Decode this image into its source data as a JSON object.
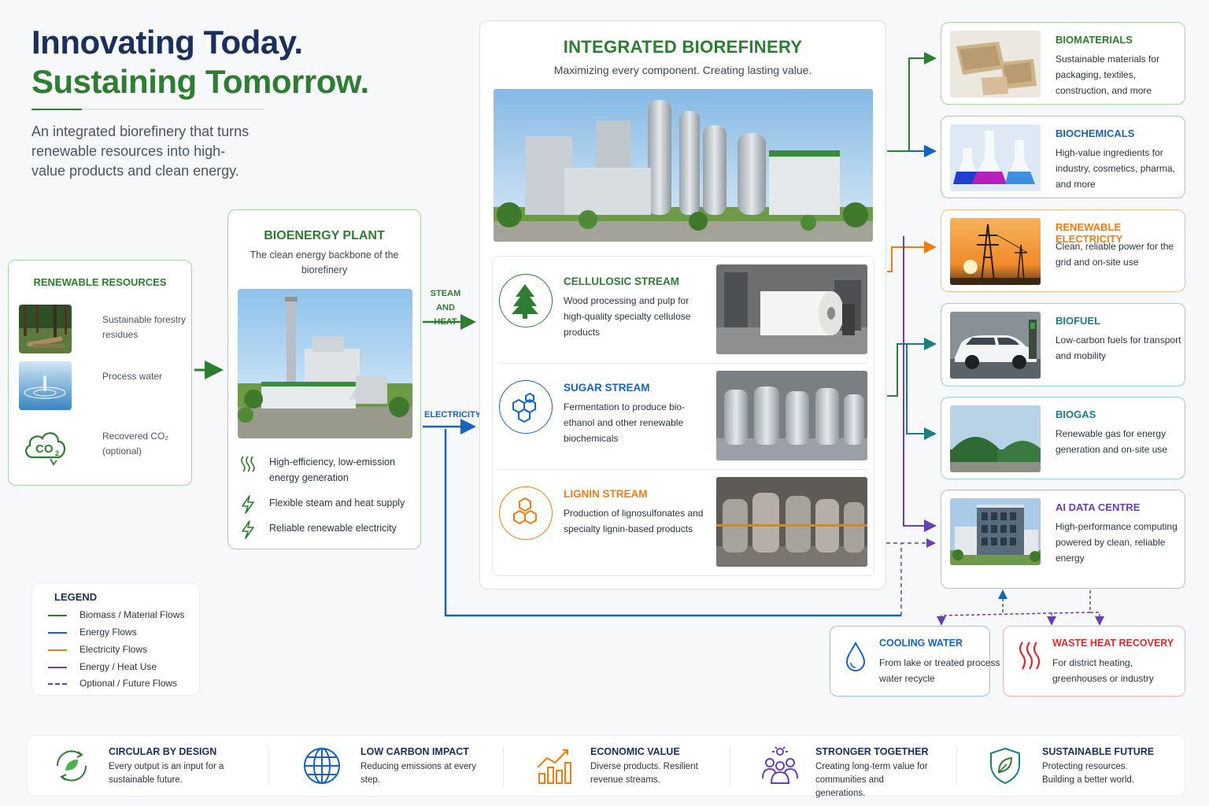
{
  "hero": {
    "line1": "Innovating Today.",
    "line2": "Sustaining Tomorrow.",
    "description": "An integrated biorefinery that turns renewable resources into high-value products and clean energy."
  },
  "resources": {
    "title": "RENEWABLE RESOURCES",
    "items": [
      {
        "label": "Sustainable forestry residues",
        "icon": "forest-photo"
      },
      {
        "label": "Process water",
        "icon": "water-drop-photo"
      },
      {
        "label": "Recovered CO₂ (optional)",
        "icon": "co2-cloud-icon"
      }
    ]
  },
  "bioenergy": {
    "title": "BIOENERGY PLANT",
    "subtitle": "The clean energy backbone of the biorefinery",
    "features": [
      {
        "label": "High-efficiency, low-emission energy generation",
        "icon": "heat-waves-icon"
      },
      {
        "label": "Flexible steam and heat supply",
        "icon": "lightning-icon"
      },
      {
        "label": "Reliable renewable electricity",
        "icon": "lightning-icon"
      }
    ]
  },
  "flows": {
    "steam": "STEAM AND HEAT",
    "electricity": "ELECTRICITY"
  },
  "refinery": {
    "title": "INTEGRATED BIOREFINERY",
    "subtitle": "Maximizing every component. Creating lasting value.",
    "streams": [
      {
        "title": "CELLULOSIC STREAM",
        "description": "Wood processing and pulp for high-quality specialty cellulose products",
        "color": "#2e7d32",
        "icon": "tree-icon"
      },
      {
        "title": "SUGAR STREAM",
        "description": "Fermentation to produce bio-ethanol and other renewable biochemicals",
        "color": "#1565c0",
        "icon": "hexagon-molecule-icon"
      },
      {
        "title": "LIGNIN STREAM",
        "description": "Production of lignosulfonates and specialty lignin-based products",
        "color": "#ef7d14",
        "icon": "hexagon-molecule-icon"
      }
    ]
  },
  "outputs": [
    {
      "title": "BIOMATERIALS",
      "description": "Sustainable materials for packaging, textiles, construction, and more",
      "color": "#2e7d32",
      "border": "#a9d3a3"
    },
    {
      "title": "BIOCHEMICALS",
      "description": "High-value ingredients for industry, cosmetics, pharma, and more",
      "color": "#1565c0",
      "border": "#9fc3ea"
    },
    {
      "title": "RENEWABLE ELECTRICITY",
      "description": "Clean, reliable power for the grid and on-site use",
      "color": "#ef7d14",
      "border": "#f5bf8a"
    },
    {
      "title": "BIOFUEL",
      "description": "Low-carbon fuels for transport and mobility",
      "color": "#1a7f80",
      "border": "#9ccfcf"
    },
    {
      "title": "BIOGAS",
      "description": "Renewable gas for energy generation and on-site use",
      "color": "#1a7f80",
      "border": "#9ccfcf"
    },
    {
      "title": "AI DATA CENTRE",
      "description": "High-performance computing powered by clean, reliable energy",
      "color": "#6a3fb5",
      "border": "#c6b4e6"
    }
  ],
  "aux": [
    {
      "title": "COOLING WATER",
      "description": "From lake or treated process water recycle",
      "color": "#1565c0",
      "icon": "water-drop-icon"
    },
    {
      "title": "WASTE HEAT RECOVERY",
      "description": "For district heating, greenhouses or industry",
      "color": "#d32f2f",
      "icon": "heat-waves-icon"
    }
  ],
  "legend": {
    "title": "LEGEND",
    "items": [
      {
        "label": "Biomass / Material Flows",
        "color": "#2e7d32",
        "style": "solid"
      },
      {
        "label": "Energy Flows",
        "color": "#1565c0",
        "style": "solid"
      },
      {
        "label": "Electricity Flows",
        "color": "#ef7d14",
        "style": "solid"
      },
      {
        "label": "Energy / Heat Use",
        "color": "#6a3fb5",
        "style": "solid"
      },
      {
        "label": "Optional / Future Flows",
        "color": "#6a3fb5",
        "style": "dashed"
      }
    ]
  },
  "footer": [
    {
      "title": "CIRCULAR BY DESIGN",
      "description": "Every output is an input for a sustainable future.",
      "icon": "circular-leaf-icon"
    },
    {
      "title": "LOW CARBON IMPACT",
      "description": "Reducing emissions at every step.",
      "icon": "globe-icon"
    },
    {
      "title": "ECONOMIC VALUE",
      "description": "Diverse products. Resilient revenue streams.",
      "icon": "bar-chart-icon"
    },
    {
      "title": "STRONGER TOGETHER",
      "description": "Creating long-term value for communities and generations.",
      "icon": "people-icon"
    },
    {
      "title": "SUSTAINABLE FUTURE",
      "description": "Protecting resources. Building a better world.",
      "icon": "shield-leaf-icon"
    }
  ]
}
